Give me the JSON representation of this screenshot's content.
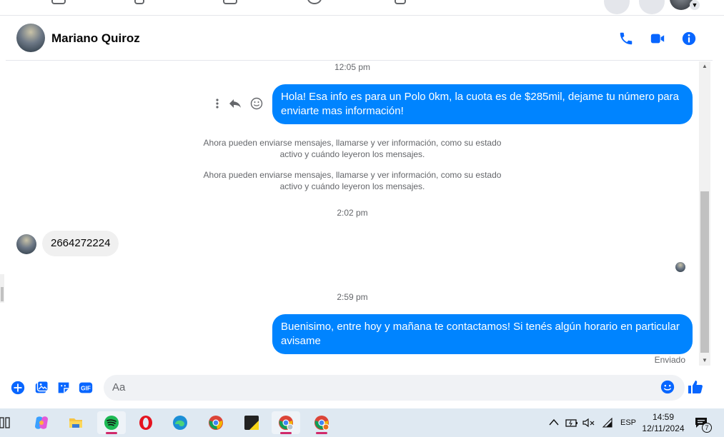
{
  "conversation": {
    "contact_name": "Mariano Quiroz"
  },
  "messages": {
    "ts1": "12:05 pm",
    "out1": "Hola! Esa info es para un Polo 0km, la cuota es de $285mil, dejame tu número para enviarte mas información!",
    "sys1": "Ahora pueden enviarse mensajes, llamarse y ver información, como su estado activo y cuándo leyeron los mensajes.",
    "sys2": "Ahora pueden enviarse mensajes, llamarse y ver información, como su estado activo y cuándo leyeron los mensajes.",
    "ts2": "2:02 pm",
    "in1": "2664272224",
    "ts3": "2:59 pm",
    "out2": "Buenisimo, entre hoy y mañana te contactamos! Si tenés algún horario en particular avisame",
    "status": "Enviado"
  },
  "composer": {
    "placeholder": "Aa"
  },
  "taskbar": {
    "language": "ESP",
    "time": "14:59",
    "date": "12/11/2024",
    "notification_count": "7",
    "apps": [
      "copilot-icon",
      "file-explorer-icon",
      "spotify-icon",
      "opera-icon",
      "edge-icon",
      "chrome-icon",
      "sticky-notes-icon",
      "chrome-profile-icon",
      "chrome-profile-2-icon"
    ]
  },
  "colors": {
    "accent": "#0866ff",
    "bubble_out": "#0084ff",
    "bubble_in": "#f0f0f0",
    "muted_text": "#65676b"
  }
}
